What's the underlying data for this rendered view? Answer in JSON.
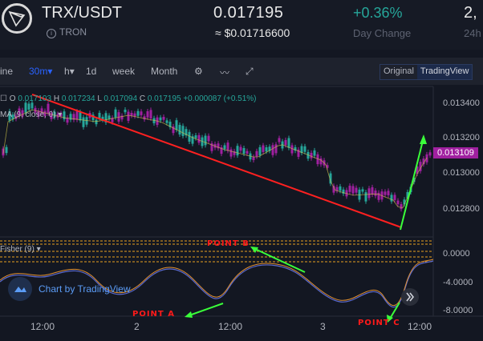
{
  "header": {
    "pair": "TRX/USDT",
    "network": "TRON",
    "price": "0.017195",
    "usd_price": "≈ $0.01716600",
    "change": "+0.36%",
    "change_label": "Day Change",
    "volume": "2,",
    "volume_label": "24h"
  },
  "toolbar": {
    "items": [
      "ine",
      "30m",
      "h",
      "1d",
      "week",
      "Month"
    ],
    "view_options": [
      "Original",
      "TradingView"
    ],
    "active_view": "TradingView"
  },
  "legend": {
    "ohlc_prefix": "O",
    "open": "0.017103",
    "high_prefix": "H",
    "high": "0.017234",
    "low_prefix": "L",
    "low": "0.017094",
    "close_prefix": "C",
    "close": "0.017195",
    "change": "+0.000087 (+0.51%)",
    "ma_label": "MA (9, close, 0)",
    "fisher_label": "Fisher (9)"
  },
  "price_axis": [
    "0.013400",
    "0.013200",
    "0.013000",
    "0.012800"
  ],
  "current_price_tag": "0.013109",
  "indicator_axis": [
    "0.0000",
    "-4.0000",
    "-8.0000"
  ],
  "time_axis": [
    "12:00",
    "2",
    "12:00",
    "3",
    "12:00"
  ],
  "branding": "Chart by TradingView",
  "annotations": {
    "point_a": "POINT A",
    "point_b": "POINT B",
    "point_c": "POINT C"
  },
  "colors": {
    "up": "#26a69a",
    "down": "#a020a0",
    "trendline": "#ff2020",
    "arrow": "#3aff3a",
    "accent": "#2962ff"
  }
}
